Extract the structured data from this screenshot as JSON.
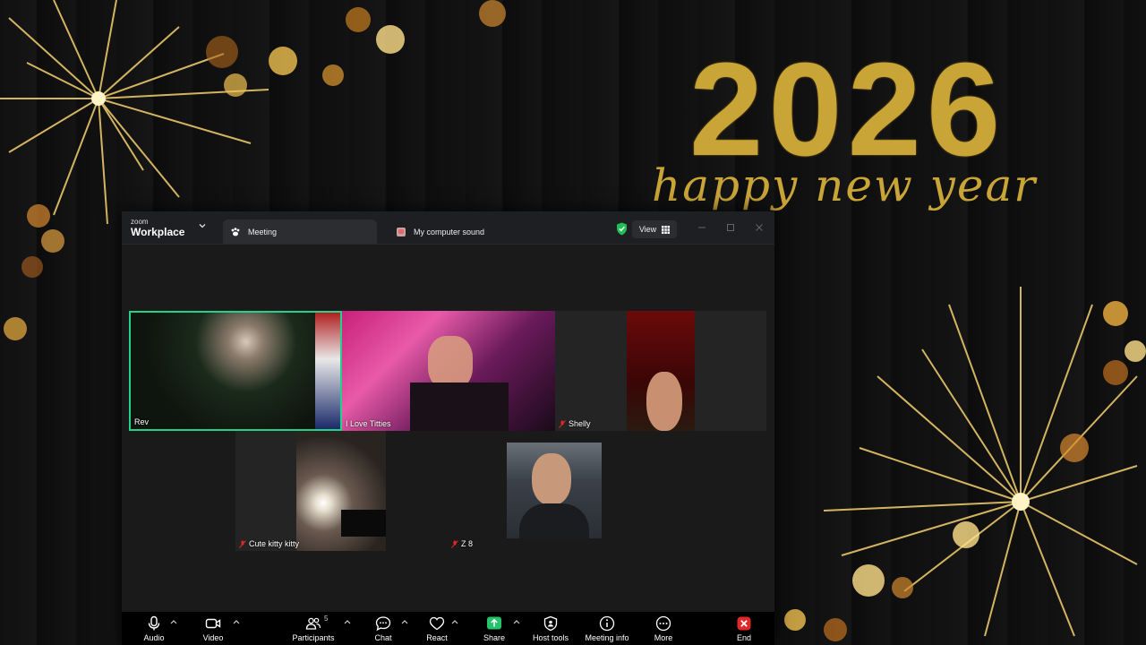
{
  "background": {
    "year": "2026",
    "greeting": "happy new year"
  },
  "window": {
    "brand_small": "zoom",
    "brand_big": "Workplace",
    "tabs": [
      {
        "label": "Meeting"
      },
      {
        "label": "My computer sound"
      }
    ],
    "view_label": "View"
  },
  "participants": [
    {
      "name": "Rev",
      "muted": false,
      "active_speaker": true
    },
    {
      "name": "I Love Titties",
      "muted": false
    },
    {
      "name": "Shelly",
      "muted": true
    },
    {
      "name": "Cute kitty kitty",
      "muted": true
    },
    {
      "name": "Z 8",
      "muted": true
    },
    {
      "name": "",
      "muted": false
    }
  ],
  "toolbar": {
    "audio": "Audio",
    "video": "Video",
    "participants": "Participants",
    "participants_count": "5",
    "chat": "Chat",
    "react": "React",
    "share": "Share",
    "host_tools": "Host tools",
    "meeting_info": "Meeting info",
    "more": "More",
    "end": "End"
  },
  "colors": {
    "active_speaker": "#23d18b",
    "share_green": "#23c26b",
    "end_red": "#e02828",
    "gold": "#c9a436"
  }
}
